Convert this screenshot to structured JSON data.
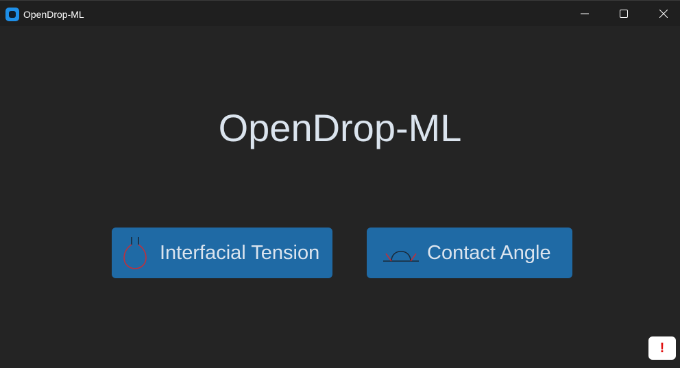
{
  "window": {
    "title": "OpenDrop-ML",
    "icon": "app-icon",
    "controls": [
      "minimize-icon",
      "maximize-icon",
      "close-icon"
    ]
  },
  "main": {
    "title": "OpenDrop-ML",
    "buttons": [
      {
        "label": "Interfacial Tension",
        "icon": "pendant-drop-icon"
      },
      {
        "label": "Contact Angle",
        "icon": "sessile-drop-icon"
      }
    ]
  },
  "alert": {
    "label": "!",
    "icon": "exclamation-icon"
  },
  "colors": {
    "background": "#242424",
    "titlebar": "#1f1f1f",
    "button": "#1f6aa5",
    "text": "#dbe4ee",
    "alert": "#e01010"
  }
}
